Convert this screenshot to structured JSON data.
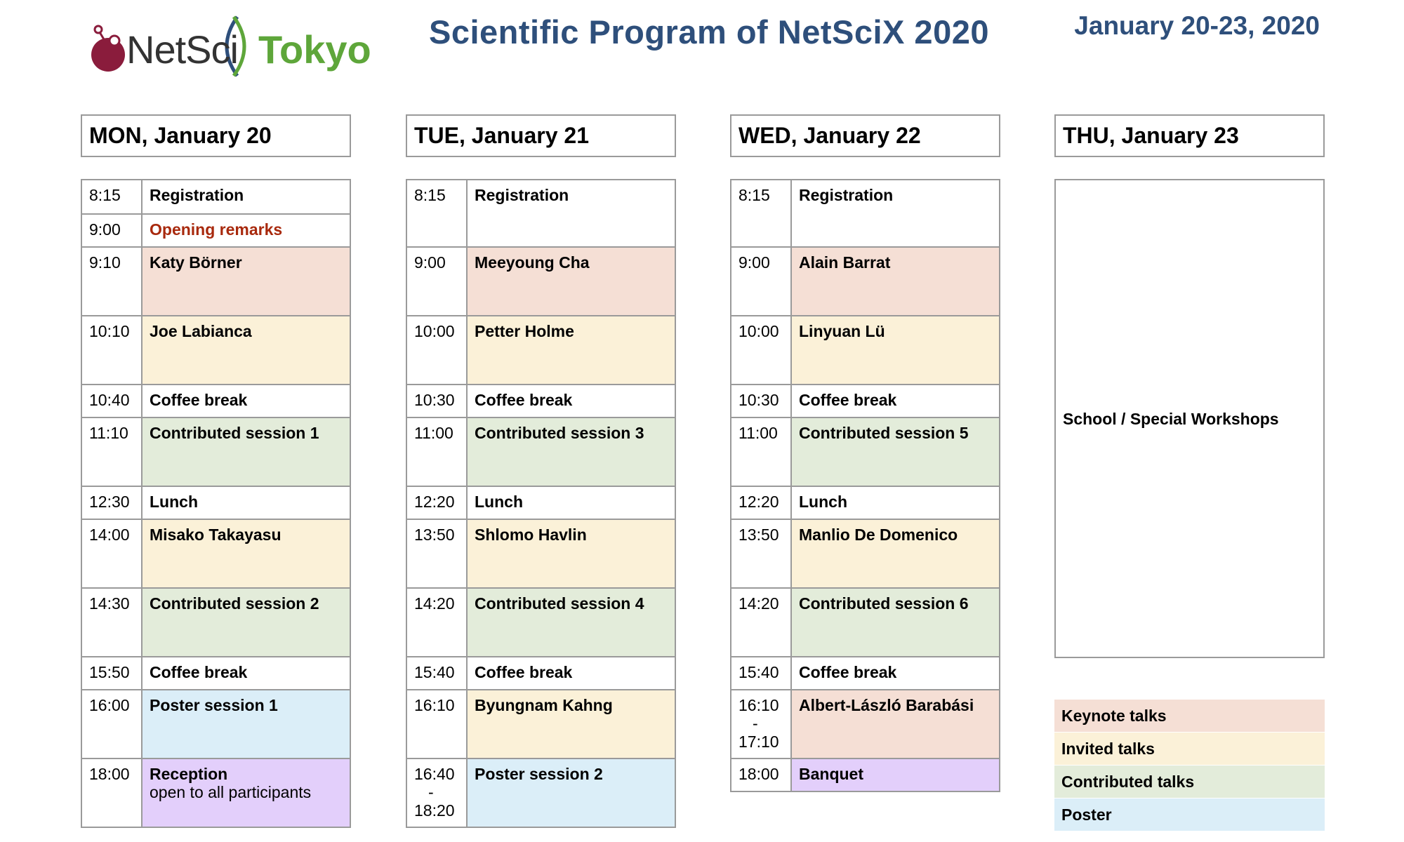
{
  "header": {
    "logo_net": "NetSci",
    "logo_tokyo": "Tokyo",
    "title": "Scientific Program of NetSciX 2020",
    "dates": "January 20-23, 2020"
  },
  "days": [
    {
      "title": "MON, January 20",
      "rows": [
        {
          "time": "8:15",
          "event": "Registration",
          "type": "plain"
        },
        {
          "time": "9:00",
          "event": "Opening remarks",
          "type": "opening"
        },
        {
          "time": "9:10",
          "event": "Katy Börner",
          "type": "keynote"
        },
        {
          "time": "10:10",
          "event": "Joe Labianca",
          "type": "invited"
        },
        {
          "time": "10:40",
          "event": "Coffee break",
          "type": "plain"
        },
        {
          "time": "11:10",
          "event": "Contributed session 1",
          "type": "contrib"
        },
        {
          "time": "12:30",
          "event": "Lunch",
          "type": "plain"
        },
        {
          "time": "14:00",
          "event": "Misako Takayasu",
          "type": "invited"
        },
        {
          "time": "14:30",
          "event": "Contributed session 2",
          "type": "contrib"
        },
        {
          "time": "15:50",
          "event": "Coffee break",
          "type": "plain"
        },
        {
          "time": "16:00",
          "event": "Poster session 1",
          "type": "poster"
        },
        {
          "time": "18:00",
          "event": "Reception",
          "sub": "open to all participants",
          "type": "social"
        }
      ]
    },
    {
      "title": "TUE, January 21",
      "rows": [
        {
          "time": "8:15",
          "event": "Registration",
          "type": "plain"
        },
        {
          "time": "9:00",
          "event": "Meeyoung Cha",
          "type": "keynote"
        },
        {
          "time": "10:00",
          "event": "Petter Holme",
          "type": "invited"
        },
        {
          "time": "10:30",
          "event": "Coffee break",
          "type": "plain"
        },
        {
          "time": "11:00",
          "event": "Contributed session 3",
          "type": "contrib"
        },
        {
          "time": "12:20",
          "event": "Lunch",
          "type": "plain"
        },
        {
          "time": "13:50",
          "event": "Shlomo Havlin",
          "type": "invited"
        },
        {
          "time": "14:20",
          "event": "Contributed session 4",
          "type": "contrib"
        },
        {
          "time": "15:40",
          "event": "Coffee break",
          "type": "plain"
        },
        {
          "time": "16:10",
          "event": "Byungnam Kahng",
          "type": "invited"
        },
        {
          "time": "16:40",
          "time_sep": "-",
          "time_end": "18:20",
          "event": "Poster session 2",
          "type": "poster"
        }
      ]
    },
    {
      "title": "WED, January 22",
      "rows": [
        {
          "time": "8:15",
          "event": "Registration",
          "type": "plain"
        },
        {
          "time": "9:00",
          "event": "Alain Barrat",
          "type": "keynote"
        },
        {
          "time": "10:00",
          "event": "Linyuan Lü",
          "type": "invited"
        },
        {
          "time": "10:30",
          "event": "Coffee break",
          "type": "plain"
        },
        {
          "time": "11:00",
          "event": "Contributed session 5",
          "type": "contrib"
        },
        {
          "time": "12:20",
          "event": "Lunch",
          "type": "plain"
        },
        {
          "time": "13:50",
          "event": "Manlio De Domenico",
          "type": "invited"
        },
        {
          "time": "14:20",
          "event": "Contributed session 6",
          "type": "contrib"
        },
        {
          "time": "15:40",
          "event": "Coffee break",
          "type": "plain"
        },
        {
          "time": "16:10",
          "time_sep": "-",
          "time_end": "17:10",
          "event": "Albert-László Barabási",
          "type": "keynote"
        },
        {
          "time": "18:00",
          "event": "Banquet",
          "type": "social"
        }
      ]
    }
  ],
  "thursday": {
    "title": "THU, January 23",
    "event": "School / Special Workshops"
  },
  "legend": [
    {
      "label": "Keynote talks",
      "type": "keynote"
    },
    {
      "label": "Invited talks",
      "type": "invited"
    },
    {
      "label": "Contributed talks",
      "type": "contrib"
    },
    {
      "label": "Poster",
      "type": "poster"
    }
  ],
  "colors": {
    "title": "#2e4f7b",
    "keynote": "#f5dfd5",
    "invited": "#fbf1d8",
    "contrib": "#e3ecda",
    "poster": "#dbeef8",
    "social": "#e3cffb",
    "opening_text": "#a8290d",
    "logo_green": "#5ea63a",
    "logo_maroon": "#8a1c3c"
  }
}
